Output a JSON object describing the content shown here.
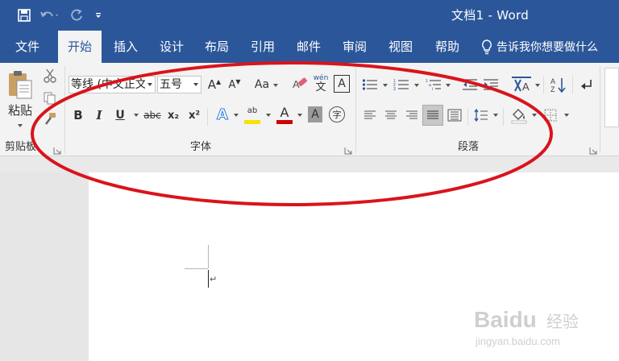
{
  "window": {
    "title": "文档1 - Word",
    "accent_color": "#2b579a",
    "annotation_color": "#d9141c"
  },
  "quick_access": {
    "save_icon": "save-icon",
    "undo_icon": "undo-icon",
    "redo_icon": "redo-icon",
    "customize_icon": "customize-qat-icon"
  },
  "tabs": [
    {
      "label": "文件"
    },
    {
      "label": "开始",
      "active": true
    },
    {
      "label": "插入"
    },
    {
      "label": "设计"
    },
    {
      "label": "布局"
    },
    {
      "label": "引用"
    },
    {
      "label": "邮件"
    },
    {
      "label": "审阅"
    },
    {
      "label": "视图"
    },
    {
      "label": "帮助"
    }
  ],
  "tell_me": "告诉我你想要做什么",
  "ribbon": {
    "clipboard": {
      "label": "剪贴板",
      "paste_label": "粘贴"
    },
    "font": {
      "label": "字体",
      "font_name": "等线 (中文正文)",
      "font_size": "五号",
      "phonetic_top": "wén",
      "phonetic_bottom": "文",
      "bold": "B",
      "italic": "I",
      "underline": "U",
      "strikethrough": "abc",
      "subscript": "x₂",
      "superscript": "x²",
      "text_effect": "A",
      "highlight": "ab",
      "font_color": "A",
      "char_shading": "A",
      "enclose": "字",
      "grow": "A",
      "shrink": "A",
      "change_case": "Aa",
      "char_border": "A"
    },
    "paragraph": {
      "label": "段落"
    }
  },
  "document": {
    "paragraph_mark": "↵"
  },
  "watermark": {
    "brand": "Baidu",
    "sub": "经验",
    "url": "jingyan.baidu.com"
  }
}
